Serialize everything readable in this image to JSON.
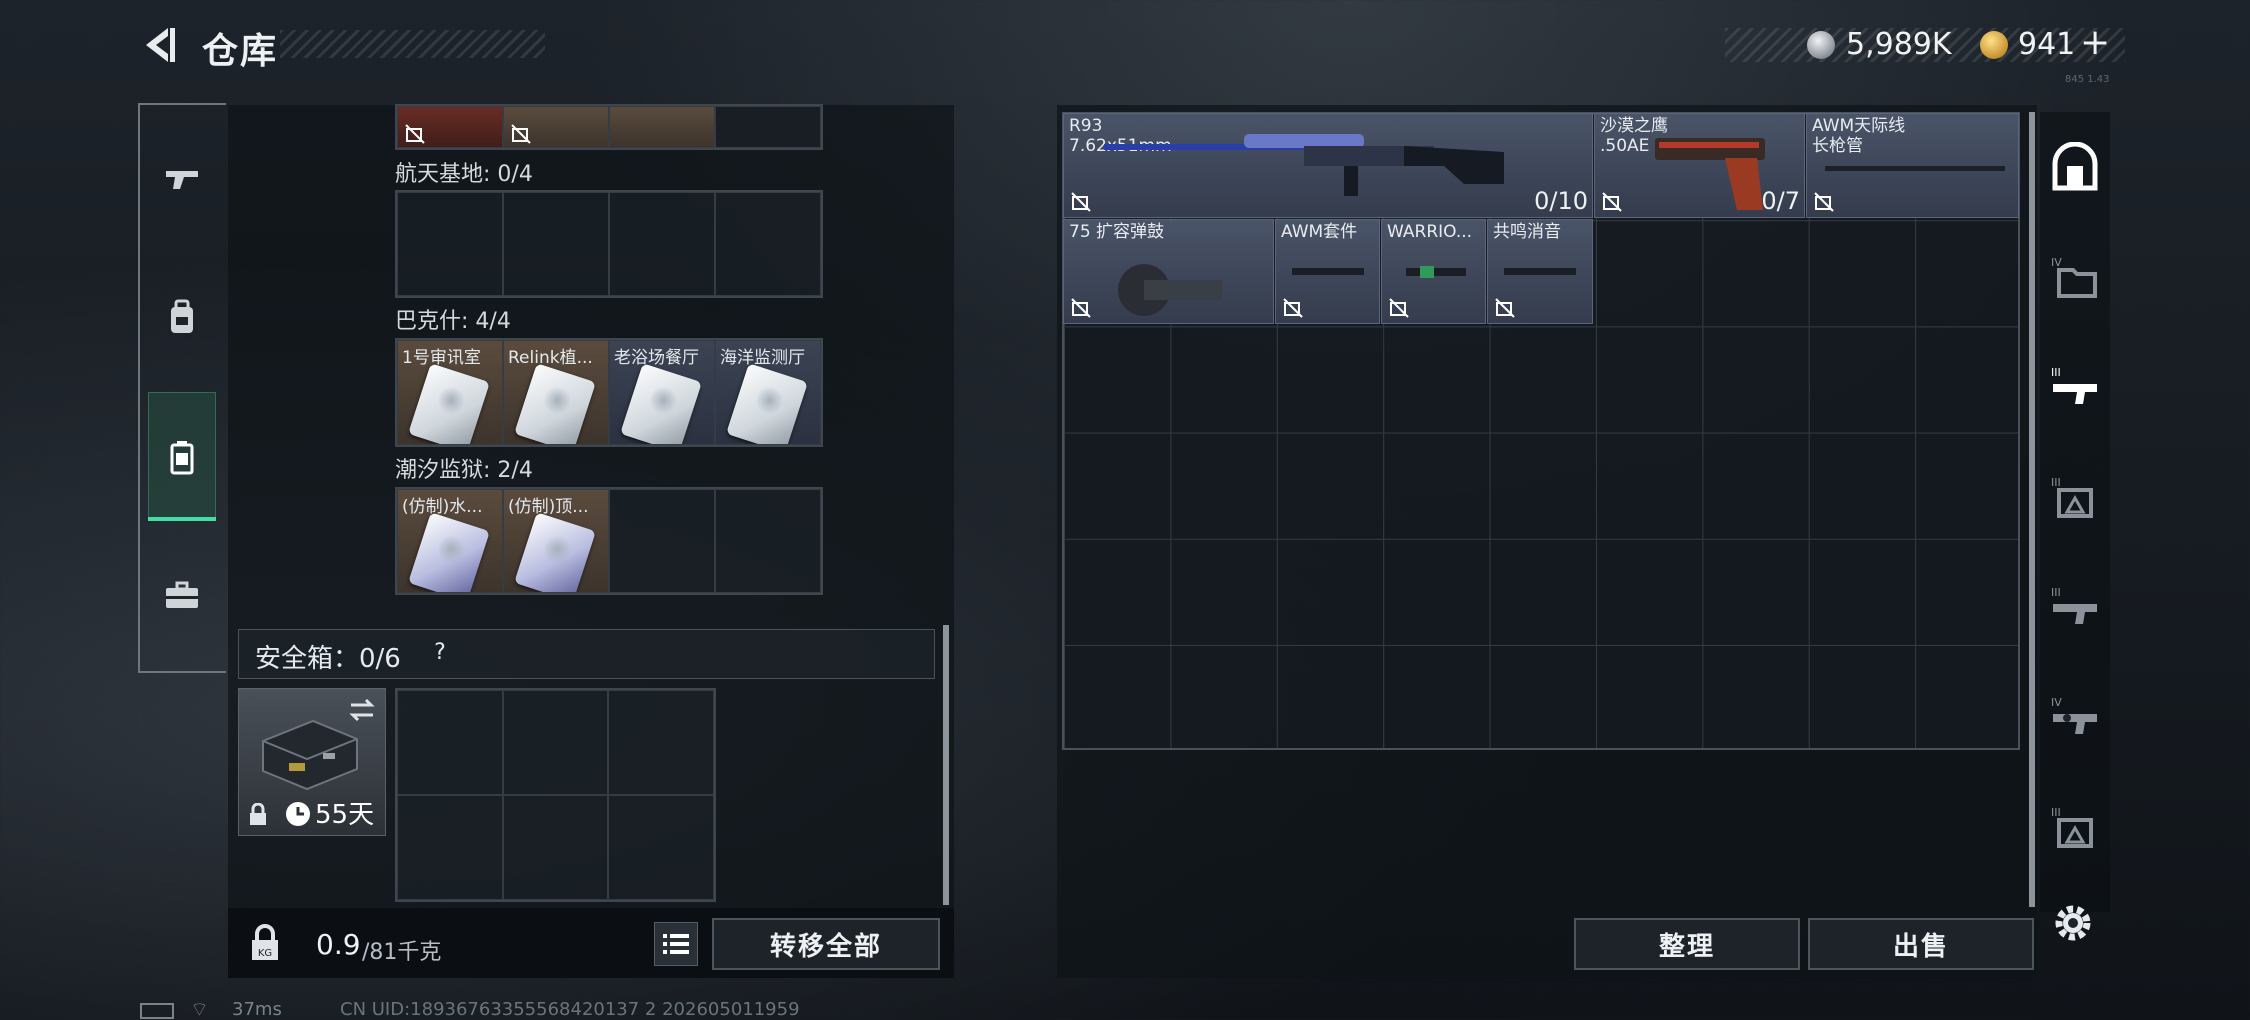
{
  "header": {
    "title": "仓库"
  },
  "currency": {
    "silver": "5,989K",
    "gold": "941",
    "add_label": "+"
  },
  "tiny_version": "845 1.43",
  "left_tabs": [
    "pistol-icon",
    "backpack-icon",
    "safe-case-icon",
    "briefcase-icon"
  ],
  "keycards": {
    "top_partial_count": 4,
    "groups": [
      {
        "label": "航天基地: 0/4",
        "cards": []
      },
      {
        "label": "巴克什: 4/4",
        "cards": [
          {
            "name": "1号审讯室",
            "bg": "brown"
          },
          {
            "name": "Relink植...",
            "bg": "brown"
          },
          {
            "name": "老浴场餐厅",
            "bg": "blue"
          },
          {
            "name": "海洋监测厅",
            "bg": "blue"
          }
        ]
      },
      {
        "label": "潮汐监狱: 2/4",
        "cards": [
          {
            "name": "(仿制)水...",
            "bg": "brown"
          },
          {
            "name": "(仿制)顶...",
            "bg": "brown"
          }
        ]
      }
    ]
  },
  "safe": {
    "label": "安全箱：0/6",
    "help": "?",
    "days": "55天"
  },
  "bottom": {
    "weight": "0.9",
    "capacity": "/81千克",
    "transfer_label": "转移全部"
  },
  "items": [
    {
      "name": "R93\n7.62x51mm",
      "count": "0/10"
    },
    {
      "name": "沙漠之鹰\n.50AE",
      "count": "0/7"
    },
    {
      "name": "AWM天际线\n长枪管",
      "count": ""
    },
    {
      "name": "75 扩容弹鼓",
      "count": ""
    },
    {
      "name": "AWM套件",
      "count": ""
    },
    {
      "name": "WARRIO...",
      "count": ""
    },
    {
      "name": "共鸣消音",
      "count": ""
    }
  ],
  "right_buttons": {
    "organize": "整理",
    "sell": "出售"
  },
  "right_tabs": [
    "vault-door-icon",
    "folder-iv-icon",
    "rifle-iii-icon",
    "armor-iii-icon",
    "rifle-iii-b-icon",
    "rifle-iv-icon",
    "armor-iii-b-icon"
  ],
  "status": {
    "ping": "37ms",
    "uid": "CN UID:18936763355568420137 2 202605011959"
  }
}
